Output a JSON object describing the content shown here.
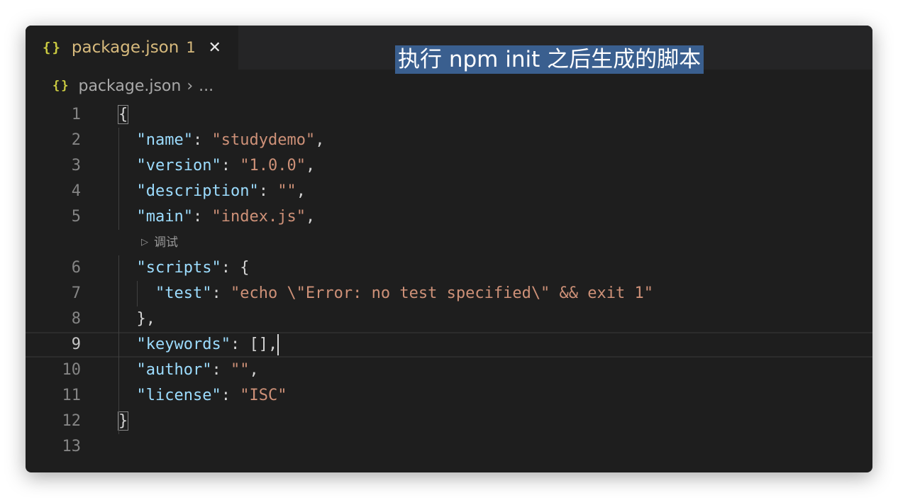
{
  "tab": {
    "icon": "json-braces-icon",
    "braces": "{}",
    "name": "package.json",
    "badge": "1",
    "close": "✕"
  },
  "caption": "执行 npm init 之后生成的脚本",
  "breadcrumb": {
    "braces": "{}",
    "file": "package.json",
    "separator": "›",
    "more": "..."
  },
  "codelens": {
    "icon": "▷",
    "label": "调试"
  },
  "active_line": 9,
  "lines": [
    {
      "n": "1",
      "text": "{"
    },
    {
      "n": "2",
      "key": "\"name\"",
      "colon": ": ",
      "value": "\"studydemo\"",
      "tail": ","
    },
    {
      "n": "3",
      "key": "\"version\"",
      "colon": ": ",
      "value": "\"1.0.0\"",
      "tail": ","
    },
    {
      "n": "4",
      "key": "\"description\"",
      "colon": ": ",
      "value": "\"\"",
      "tail": ","
    },
    {
      "n": "5",
      "key": "\"main\"",
      "colon": ": ",
      "value": "\"index.js\"",
      "tail": ","
    },
    {
      "n": "6",
      "key": "\"scripts\"",
      "colon": ": ",
      "value": "",
      "tail": "{"
    },
    {
      "n": "7",
      "key": "\"test\"",
      "colon": ": ",
      "value": "\"echo \\\"Error: no test specified\\\" && exit 1\"",
      "tail": ""
    },
    {
      "n": "8",
      "text": "},"
    },
    {
      "n": "9",
      "key": "\"keywords\"",
      "colon": ": ",
      "value": "",
      "tail": "[],"
    },
    {
      "n": "10",
      "key": "\"author\"",
      "colon": ": ",
      "value": "\"\"",
      "tail": ","
    },
    {
      "n": "11",
      "key": "\"license\"",
      "colon": ": ",
      "value": "\"ISC\"",
      "tail": ""
    },
    {
      "n": "12",
      "text": "}"
    },
    {
      "n": "13",
      "text": ""
    }
  ]
}
